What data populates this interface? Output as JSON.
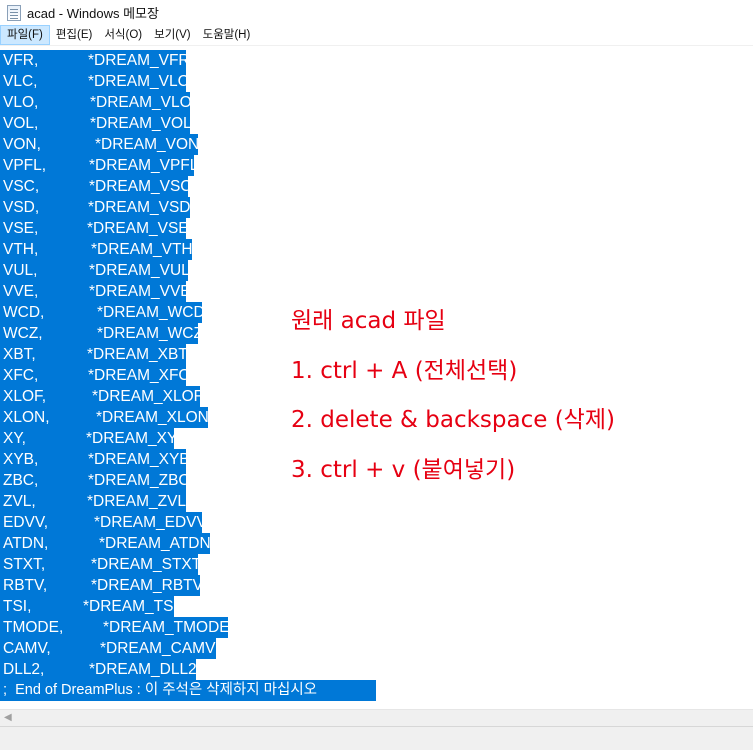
{
  "window": {
    "title": "acad - Windows 메모장"
  },
  "menu": [
    {
      "label": "파일(F)",
      "active": true
    },
    {
      "label": "편집(E)",
      "active": false
    },
    {
      "label": "서식(O)",
      "active": false
    },
    {
      "label": "보기(V)",
      "active": false
    },
    {
      "label": "도움말(H)",
      "active": false
    }
  ],
  "editor": {
    "lines": [
      {
        "alias": "VFR,",
        "command": "*DREAM_VFR"
      },
      {
        "alias": "VLC,",
        "command": "*DREAM_VLC"
      },
      {
        "alias": "VLO,",
        "command": "*DREAM_VLO"
      },
      {
        "alias": "VOL,",
        "command": "*DREAM_VOL"
      },
      {
        "alias": "VON,",
        "command": "*DREAM_VON"
      },
      {
        "alias": "VPFL,",
        "command": "*DREAM_VPFL"
      },
      {
        "alias": "VSC,",
        "command": "*DREAM_VSC"
      },
      {
        "alias": "VSD,",
        "command": "*DREAM_VSD"
      },
      {
        "alias": "VSE,",
        "command": "*DREAM_VSE"
      },
      {
        "alias": "VTH,",
        "command": "*DREAM_VTH"
      },
      {
        "alias": "VUL,",
        "command": "*DREAM_VUL"
      },
      {
        "alias": "VVE,",
        "command": "*DREAM_VVE"
      },
      {
        "alias": "WCD,",
        "command": "*DREAM_WCD"
      },
      {
        "alias": "WCZ,",
        "command": "*DREAM_WCZ"
      },
      {
        "alias": "XBT,",
        "command": "*DREAM_XBT"
      },
      {
        "alias": "XFC,",
        "command": "*DREAM_XFC"
      },
      {
        "alias": "XLOF,",
        "command": "*DREAM_XLOF"
      },
      {
        "alias": "XLON,",
        "command": "*DREAM_XLON"
      },
      {
        "alias": "XY,",
        "command": "*DREAM_XY"
      },
      {
        "alias": "XYB,",
        "command": "*DREAM_XYB"
      },
      {
        "alias": "ZBC,",
        "command": "*DREAM_ZBC"
      },
      {
        "alias": "ZVL,",
        "command": "*DREAM_ZVL"
      },
      {
        "alias": "EDVV,",
        "command": "*DREAM_EDVV"
      },
      {
        "alias": "ATDN,",
        "command": "*DREAM_ATDN"
      },
      {
        "alias": "STXT,",
        "command": "*DREAM_STXT"
      },
      {
        "alias": "RBTV,",
        "command": "*DREAM_RBTV"
      },
      {
        "alias": "TSI,",
        "command": "*DREAM_TSI"
      },
      {
        "alias": "TMODE,",
        "command": "*DREAM_TMODE"
      },
      {
        "alias": "CAMV,",
        "command": "*DREAM_CAMV"
      },
      {
        "alias": "DLL2,",
        "command": "*DREAM_DLL2"
      }
    ],
    "footer_line": ";  End of DreamPlus : 이 주석은 삭제하지 마십시오",
    "selection_color": "#0078d7"
  },
  "annotation": {
    "color": "#e60012",
    "lines": [
      "원래 acad 파일",
      "1. ctrl + A (전체선택)",
      "2. delete & backspace (삭제)",
      "3. ctrl + v (붙여넣기)"
    ]
  }
}
